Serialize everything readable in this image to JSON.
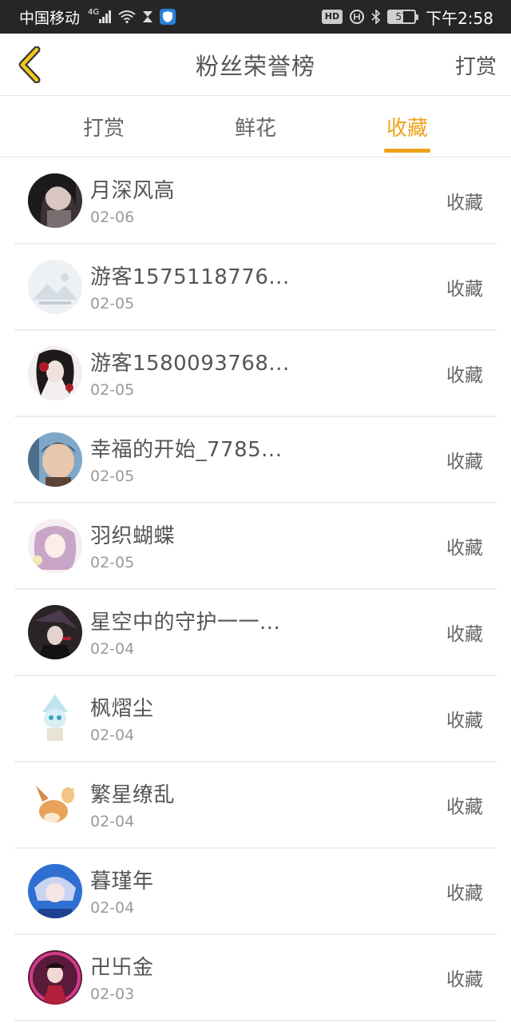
{
  "status_bar": {
    "carrier": "中国移动",
    "network": "4G",
    "hd": "HD",
    "battery": "57",
    "time": "下午2:58"
  },
  "header": {
    "title": "粉丝荣誉榜",
    "action": "打赏"
  },
  "tabs": [
    {
      "label": "打赏",
      "active": false
    },
    {
      "label": "鲜花",
      "active": false
    },
    {
      "label": "收藏",
      "active": true
    }
  ],
  "colors": {
    "accent": "#f0a21c",
    "status_bar_bg": "#262626"
  },
  "fans": [
    {
      "name": "月深风高",
      "date": "02-06",
      "action": "收藏"
    },
    {
      "name": "游客1575118776...",
      "date": "02-05",
      "action": "收藏"
    },
    {
      "name": "游客1580093768...",
      "date": "02-05",
      "action": "收藏"
    },
    {
      "name": "幸福的开始_7785...",
      "date": "02-05",
      "action": "收藏"
    },
    {
      "name": "羽织蝴蝶",
      "date": "02-05",
      "action": "收藏"
    },
    {
      "name": "星空中的守护一一...",
      "date": "02-04",
      "action": "收藏"
    },
    {
      "name": "枫熠尘",
      "date": "02-04",
      "action": "收藏"
    },
    {
      "name": "繁星缭乱",
      "date": "02-04",
      "action": "收藏"
    },
    {
      "name": "暮瑾年",
      "date": "02-04",
      "action": "收藏"
    },
    {
      "name": "卍卐金",
      "date": "02-03",
      "action": "收藏"
    }
  ]
}
